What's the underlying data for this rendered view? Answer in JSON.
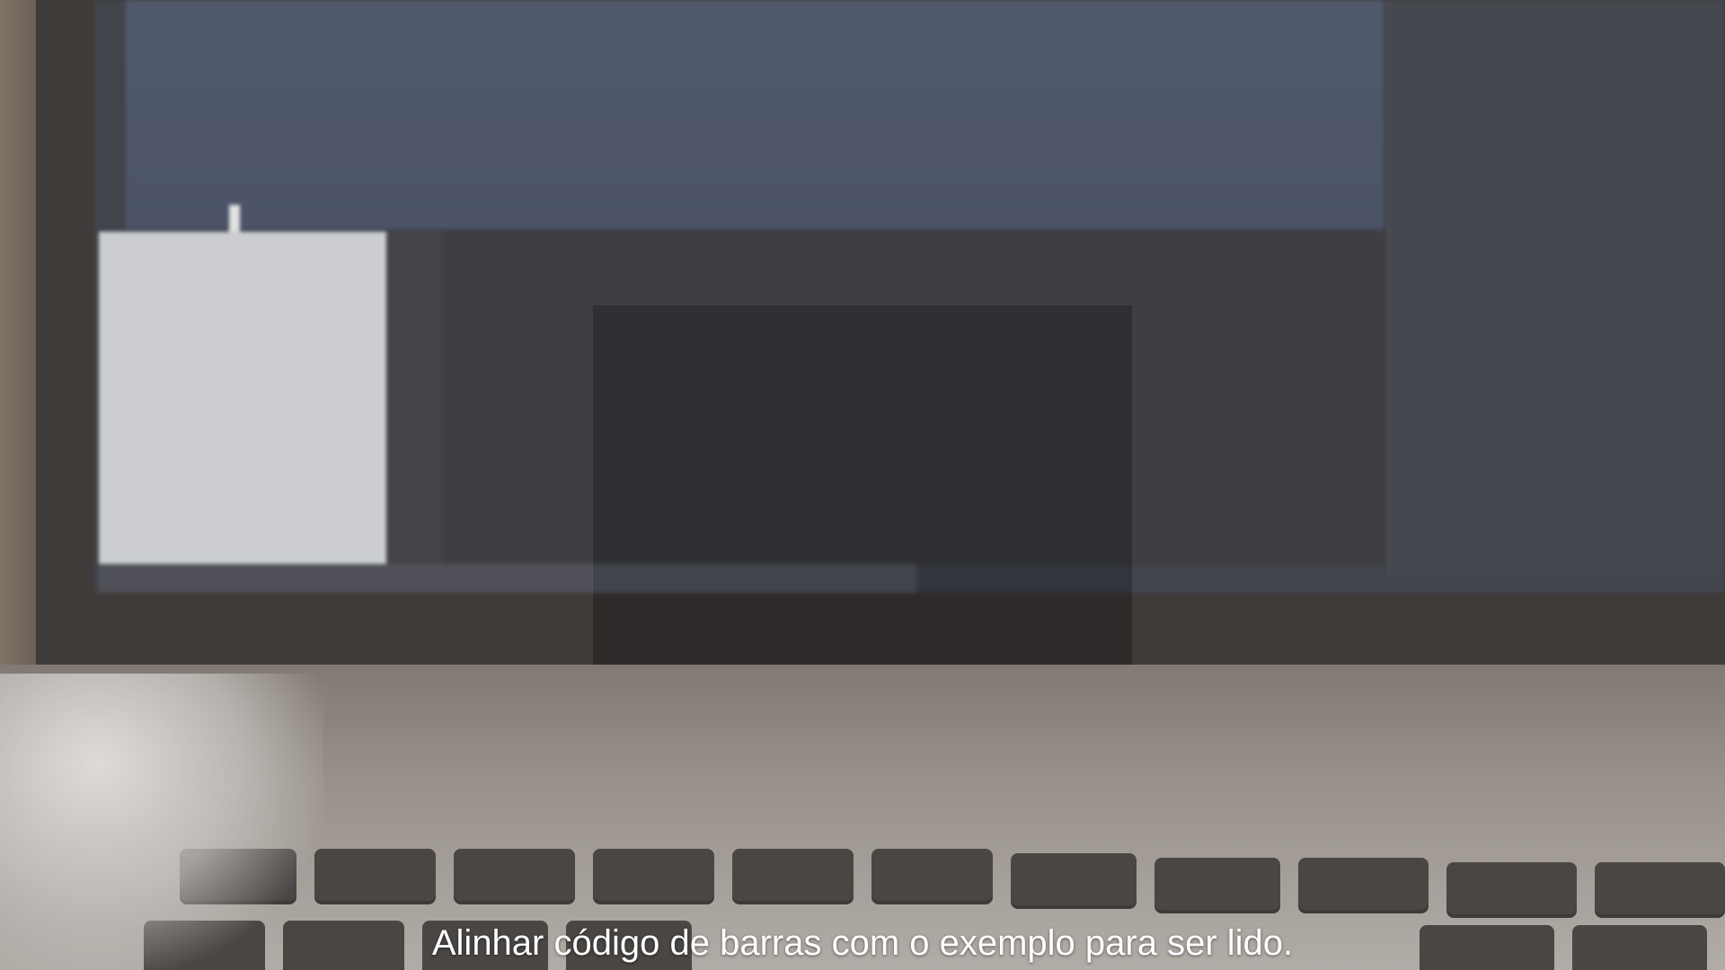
{
  "instruction": "Alinhar código de barras com o exemplo para ser lido."
}
